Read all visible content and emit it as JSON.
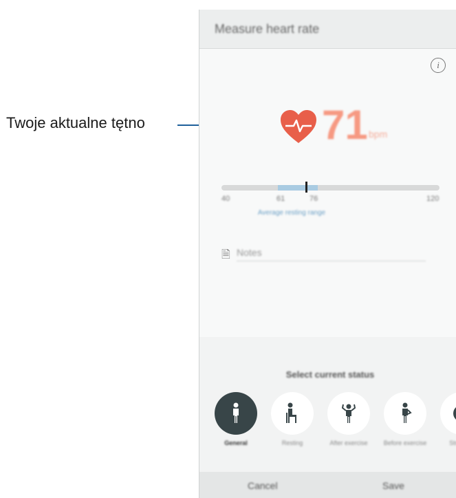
{
  "callout": {
    "label": "Twoje aktualne tętno"
  },
  "app_bar": {
    "title": "Measure heart rate"
  },
  "heart_rate": {
    "value": "71",
    "unit": "bpm"
  },
  "range": {
    "ticks": [
      "40",
      "61",
      "76",
      "120"
    ],
    "label": "Average resting range"
  },
  "notes": {
    "placeholder": "Notes"
  },
  "status_sheet": {
    "title": "Select current status",
    "options": [
      {
        "label": "General",
        "selected": true
      },
      {
        "label": "Resting",
        "selected": false
      },
      {
        "label": "After exercise",
        "selected": false
      },
      {
        "label": "Before exercise",
        "selected": false
      },
      {
        "label": "Stressed",
        "selected": false
      }
    ]
  },
  "footer": {
    "cancel_label": "Cancel",
    "save_label": "Save"
  },
  "colors": {
    "accent": "#f6795b",
    "range": "#a9cbe2",
    "selected": "#384548",
    "callout_line": "#1d5f9a"
  }
}
